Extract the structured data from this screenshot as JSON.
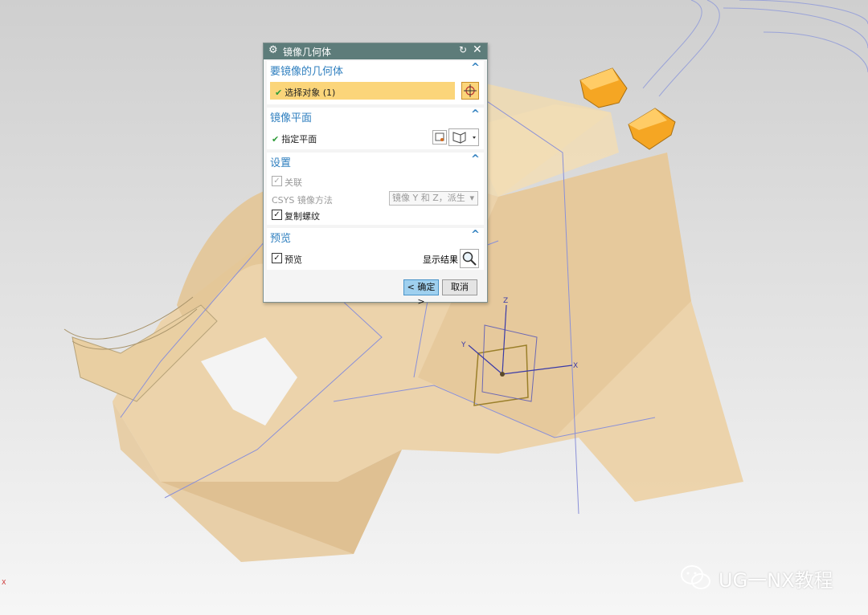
{
  "dialog": {
    "title": "镜像几何体",
    "section_geometry": {
      "heading": "要镜像的几何体",
      "select_label": "选择对象 (1)"
    },
    "section_plane": {
      "heading": "镜像平面",
      "specify_label": "指定平面"
    },
    "section_settings": {
      "heading": "设置",
      "associative_label": "关联",
      "csys_label": "CSYS 镜像方法",
      "csys_value": "镜像 Y 和 Z，派生",
      "copy_threads_label": "复制螺纹"
    },
    "section_preview": {
      "heading": "预览",
      "preview_label": "预览",
      "show_result_label": "显示结果"
    },
    "ok_label": "< 确定 >",
    "cancel_label": "取消"
  },
  "viewport": {
    "axes": {
      "x": "X",
      "y": "Y",
      "z": "Z"
    },
    "corner_axis": "X"
  },
  "watermark": {
    "text": "UG一NX教程"
  },
  "colors": {
    "part": "#ecd2a8",
    "highlight": "#f5a623",
    "titlebar": "#5d7c7a",
    "accent": "#2f7fbf"
  }
}
